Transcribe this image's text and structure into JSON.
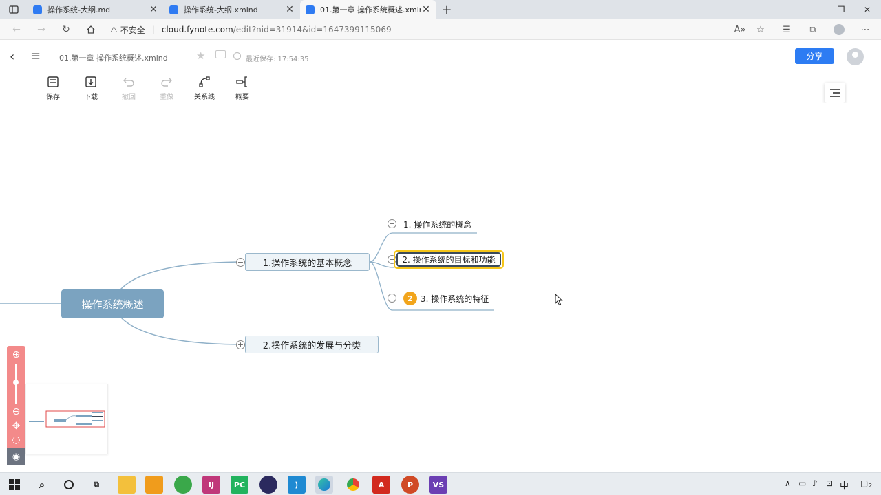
{
  "browser": {
    "tabs": [
      {
        "title": "操作系统-大纲.md",
        "active": false
      },
      {
        "title": "操作系统-大纲.xmind",
        "active": false
      },
      {
        "title": "01.第一章 操作系统概述.xmind",
        "active": true
      }
    ],
    "security_label": "不安全",
    "url_host": "cloud.fynote.com",
    "url_path": "/edit?nid=31914&id=1647399115069"
  },
  "header": {
    "doc_title": "01.第一章 操作系统概述.xmind",
    "save_status": "最近保存: 17:54:35",
    "share_label": "分享"
  },
  "toolbar": {
    "save": "保存",
    "download": "下载",
    "undo": "撤回",
    "redo": "重做",
    "relation": "关系线",
    "summary": "概要"
  },
  "mindmap": {
    "root": "操作系统概述",
    "branch1": "1.操作系统的基本概念",
    "branch2": "2.操作系统的发展与分类",
    "sub1": "1. 操作系统的概念",
    "sub2": "2. 操作系统的目标和功能",
    "sub3": "3. 操作系统的特征",
    "sub3_badge": "2"
  },
  "taskbar": {
    "ime": "中",
    "notif_count": "2"
  },
  "colors": {
    "root": "#7ba3c0",
    "accent": "#2d7cf3",
    "selection": "#f5c518",
    "zoom_panel": "#f38a8a",
    "badge": "#f2a51c"
  }
}
